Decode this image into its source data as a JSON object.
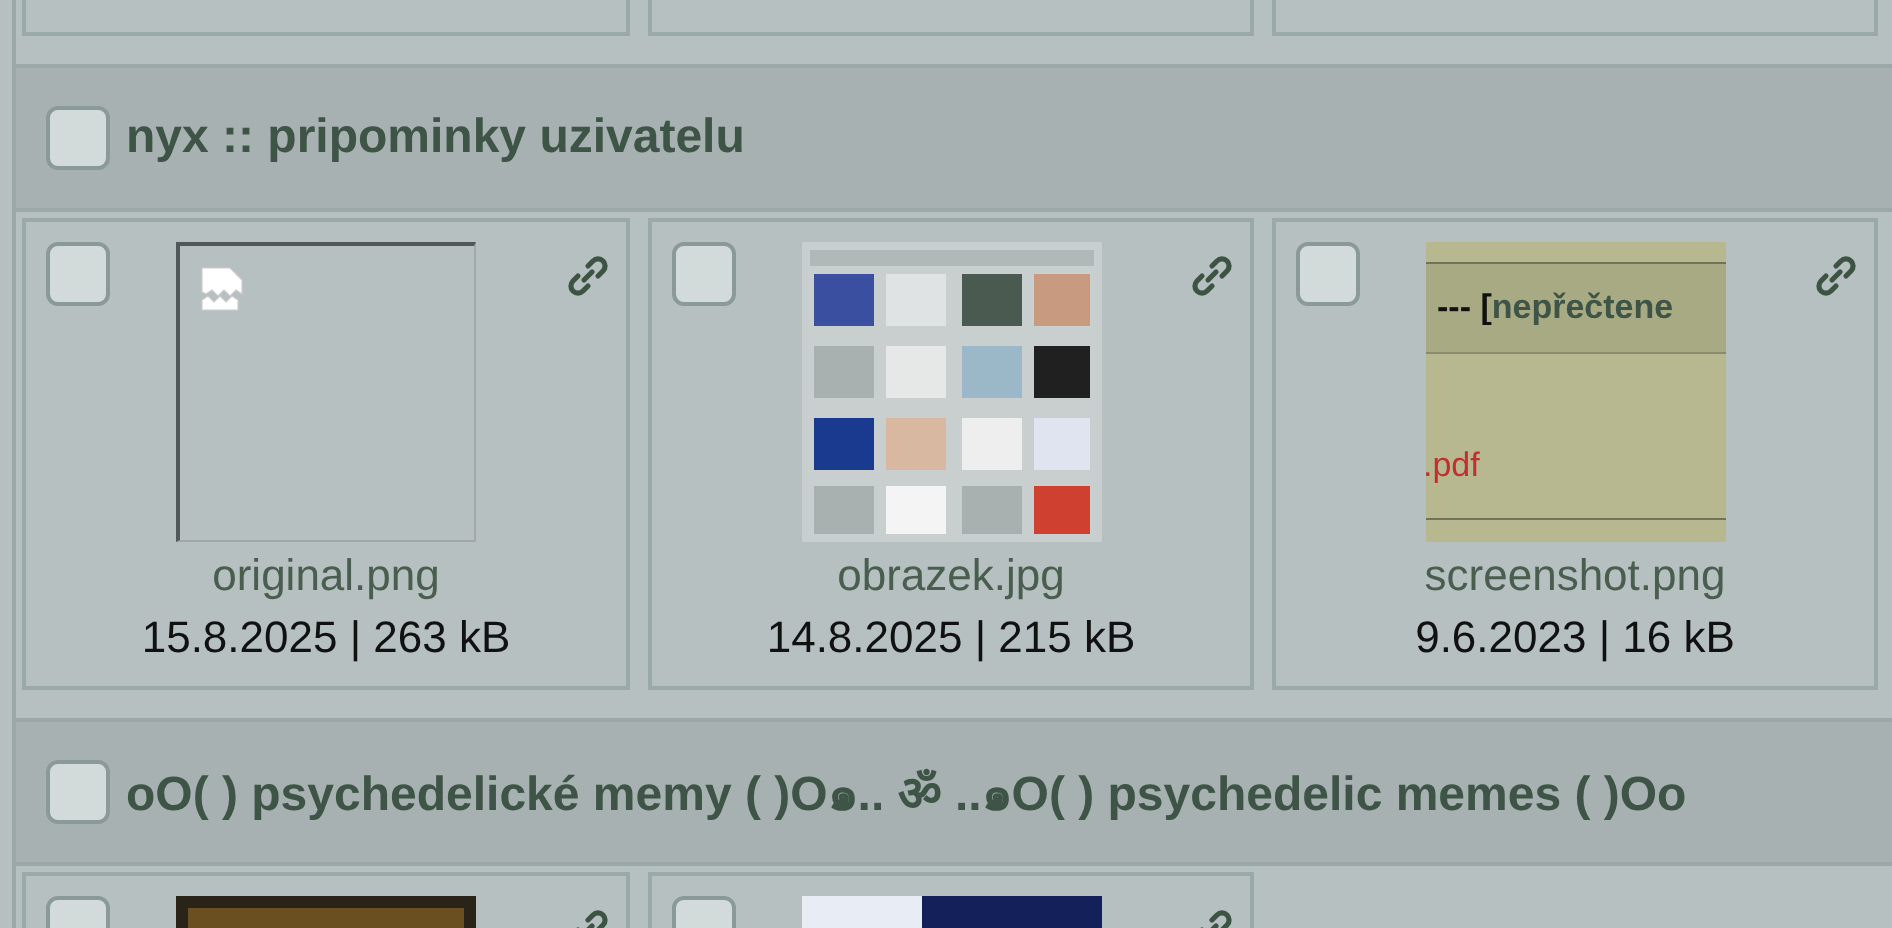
{
  "groups": [
    {
      "title": "nyx :: pripominky uzivatelu",
      "checked": false,
      "cards": [
        {
          "checked": false,
          "thumbnail": {
            "kind": "broken"
          },
          "name": "original.png",
          "info": "15.8.2025 | 263 kB"
        },
        {
          "checked": false,
          "name": "obrazek.jpg",
          "info": "14.8.2025 | 215 kB"
        },
        {
          "checked": false,
          "thumbnail": {
            "kind": "screenshot",
            "heading": "--- [",
            "highlight": "nepřečtene",
            "link": ".pdf"
          },
          "name": "screenshot.png",
          "info": "9.6.2023 | 16 kB"
        }
      ]
    },
    {
      "title": "oO( ) psychedelické memy ( )O๑.. ॐ ..๑O( ) psychedelic memes ( )Oo",
      "checked": false,
      "cards": [
        {
          "checked": false
        },
        {
          "checked": false
        }
      ]
    }
  ]
}
